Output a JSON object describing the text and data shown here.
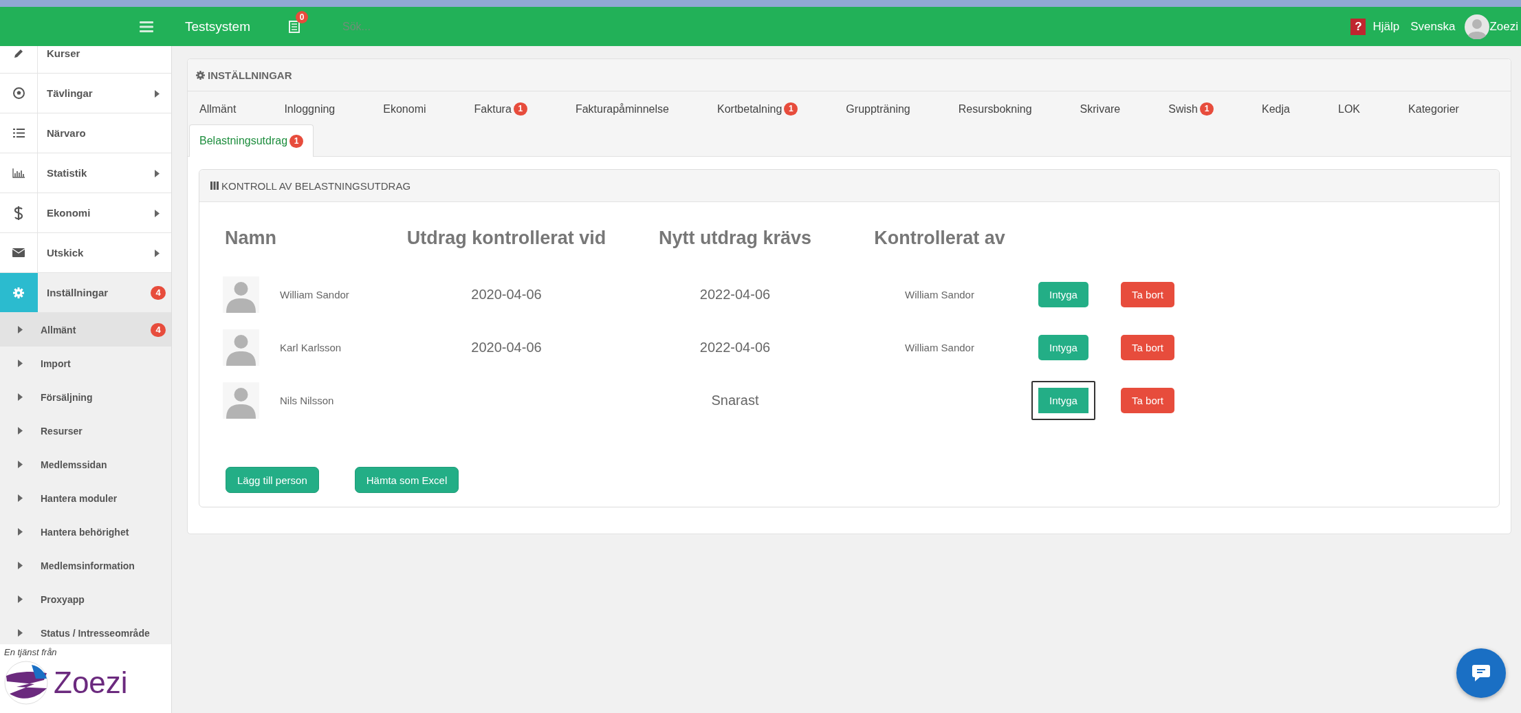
{
  "header": {
    "title": "Testsystem",
    "notifications": "0",
    "search": {
      "placeholder": "Sök..."
    },
    "help": {
      "icon": "?",
      "label": "Hjälp"
    },
    "language": "Svenska",
    "user": "Zoezi"
  },
  "sidebar": {
    "items": [
      {
        "label": "Kurser",
        "selected": false,
        "expandable": false
      },
      {
        "label": "Tävlingar",
        "selected": false,
        "expandable": true
      },
      {
        "label": "Närvaro",
        "selected": false,
        "expandable": false
      },
      {
        "label": "Statistik",
        "selected": false,
        "expandable": true
      },
      {
        "label": "Ekonomi",
        "selected": false,
        "expandable": true
      },
      {
        "label": "Utskick",
        "selected": false,
        "expandable": true
      },
      {
        "label": "Inställningar",
        "selected": true,
        "expandable": false,
        "badge": "4",
        "children": [
          {
            "label": "Allmänt",
            "selected": true,
            "badge": "4"
          },
          {
            "label": "Import",
            "selected": false
          },
          {
            "label": "Försäljning",
            "selected": false
          },
          {
            "label": "Resurser",
            "selected": false
          },
          {
            "label": "Medlemssidan",
            "selected": false
          },
          {
            "label": "Hantera moduler",
            "selected": false
          },
          {
            "label": "Hantera behörighet",
            "selected": false
          },
          {
            "label": "Medlemsinformation",
            "selected": false
          },
          {
            "label": "Proxyapp",
            "selected": false
          },
          {
            "label": "Status / Intresseområde",
            "selected": false
          }
        ]
      }
    ],
    "footer": {
      "caption": "En tjänst från",
      "logo": "Zoezi"
    }
  },
  "settings": {
    "title": "INSTÄLLNINGAR",
    "tab_rows": [
      [
        {
          "label": "Allmänt",
          "selected": false
        },
        {
          "label": "Inloggning",
          "selected": false
        },
        {
          "label": "Ekonomi",
          "selected": false
        },
        {
          "label": "Faktura",
          "selected": false,
          "badge": "1"
        },
        {
          "label": "Fakturapåminnelse",
          "selected": false
        },
        {
          "label": "Kortbetalning",
          "selected": false,
          "badge": "1"
        },
        {
          "label": "Gruppträning",
          "selected": false
        },
        {
          "label": "Resursbokning",
          "selected": false
        },
        {
          "label": "Skrivare",
          "selected": false
        },
        {
          "label": "Swish",
          "selected": false,
          "badge": "1"
        },
        {
          "label": "Kedja",
          "selected": false
        },
        {
          "label": "LOK",
          "selected": false
        },
        {
          "label": "Kategorier",
          "selected": false
        }
      ],
      [
        {
          "label": "Belastningsutdrag",
          "selected": true,
          "badge": "1"
        }
      ]
    ],
    "section": {
      "title": "KONTROLL AV BELASTNINGSUTDRAG",
      "columns": [
        "Namn",
        "Utdrag kontrollerat vid",
        "Nytt utdrag krävs",
        "Kontrollerat av"
      ],
      "rows": [
        {
          "name": "William Sandor",
          "checked_date": "2020-04-06",
          "next_date": "2022-04-06",
          "checked_by": "William Sandor",
          "actions": [
            {
              "label": "Intyga",
              "kind": "confirm",
              "focused": false
            },
            {
              "label": "Ta bort",
              "kind": "delete",
              "focused": false
            }
          ]
        },
        {
          "name": "Karl Karlsson",
          "checked_date": "2020-04-06",
          "next_date": "2022-04-06",
          "checked_by": "William Sandor",
          "actions": [
            {
              "label": "Intyga",
              "kind": "confirm",
              "focused": false
            },
            {
              "label": "Ta bort",
              "kind": "delete",
              "focused": false
            }
          ]
        },
        {
          "name": "Nils Nilsson",
          "next_date": "Snarast",
          "actions": [
            {
              "label": "Intyga",
              "kind": "confirm",
              "focused": true
            },
            {
              "label": "Ta bort",
              "kind": "delete",
              "focused": false
            }
          ]
        }
      ],
      "buttons": [
        "Lägg till person",
        "Hämta som Excel"
      ]
    }
  }
}
